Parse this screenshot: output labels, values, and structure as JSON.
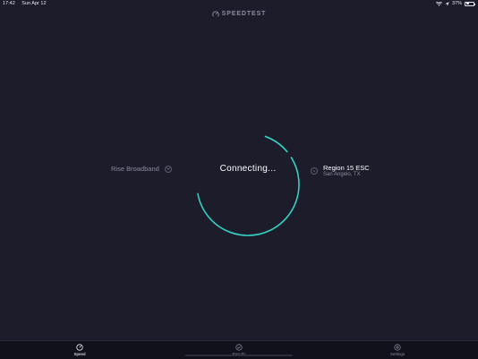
{
  "status_bar": {
    "time": "17:42",
    "date": "Sun Apr 12",
    "battery_percent": "37%",
    "battery_level": 0.37,
    "icons": [
      "wifi-icon",
      "location-icon",
      "battery-icon"
    ]
  },
  "header": {
    "logo_text": "SPEEDTEST"
  },
  "isp": {
    "name": "Rise Broadband"
  },
  "test": {
    "status_text": "Connecting...",
    "ring_color": "#34d1c4"
  },
  "server": {
    "name": "Region 15 ESC",
    "location": "San Angelo, TX"
  },
  "tabs": [
    {
      "label": "Speed",
      "icon": "gauge-icon",
      "active": true
    },
    {
      "label": "Results",
      "icon": "check-circle-icon",
      "active": false
    },
    {
      "label": "Settings",
      "icon": "gear-icon",
      "active": false
    }
  ],
  "colors": {
    "background": "#1c1c2b",
    "tabbar": "#11111b",
    "accent": "#34d1c4",
    "muted_text": "#8b8b9d"
  }
}
